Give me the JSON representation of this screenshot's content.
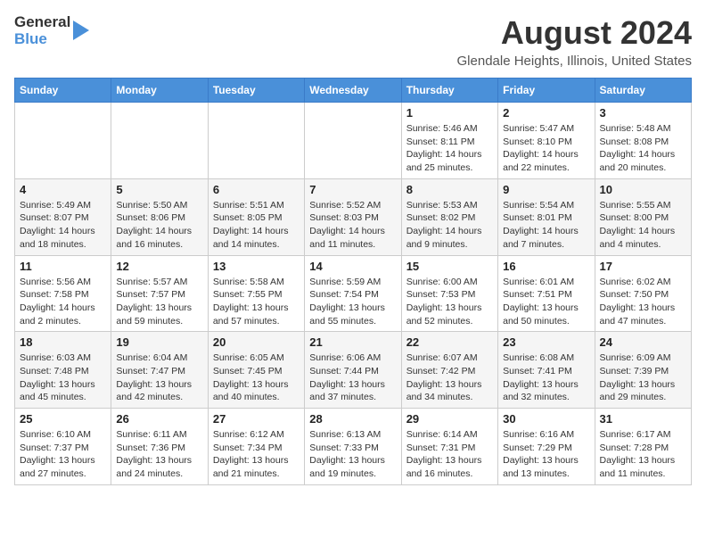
{
  "header": {
    "logo_line1": "General",
    "logo_line2": "Blue",
    "month": "August 2024",
    "location": "Glendale Heights, Illinois, United States"
  },
  "weekdays": [
    "Sunday",
    "Monday",
    "Tuesday",
    "Wednesday",
    "Thursday",
    "Friday",
    "Saturday"
  ],
  "weeks": [
    [
      {
        "day": "",
        "info": ""
      },
      {
        "day": "",
        "info": ""
      },
      {
        "day": "",
        "info": ""
      },
      {
        "day": "",
        "info": ""
      },
      {
        "day": "1",
        "info": "Sunrise: 5:46 AM\nSunset: 8:11 PM\nDaylight: 14 hours\nand 25 minutes."
      },
      {
        "day": "2",
        "info": "Sunrise: 5:47 AM\nSunset: 8:10 PM\nDaylight: 14 hours\nand 22 minutes."
      },
      {
        "day": "3",
        "info": "Sunrise: 5:48 AM\nSunset: 8:08 PM\nDaylight: 14 hours\nand 20 minutes."
      }
    ],
    [
      {
        "day": "4",
        "info": "Sunrise: 5:49 AM\nSunset: 8:07 PM\nDaylight: 14 hours\nand 18 minutes."
      },
      {
        "day": "5",
        "info": "Sunrise: 5:50 AM\nSunset: 8:06 PM\nDaylight: 14 hours\nand 16 minutes."
      },
      {
        "day": "6",
        "info": "Sunrise: 5:51 AM\nSunset: 8:05 PM\nDaylight: 14 hours\nand 14 minutes."
      },
      {
        "day": "7",
        "info": "Sunrise: 5:52 AM\nSunset: 8:03 PM\nDaylight: 14 hours\nand 11 minutes."
      },
      {
        "day": "8",
        "info": "Sunrise: 5:53 AM\nSunset: 8:02 PM\nDaylight: 14 hours\nand 9 minutes."
      },
      {
        "day": "9",
        "info": "Sunrise: 5:54 AM\nSunset: 8:01 PM\nDaylight: 14 hours\nand 7 minutes."
      },
      {
        "day": "10",
        "info": "Sunrise: 5:55 AM\nSunset: 8:00 PM\nDaylight: 14 hours\nand 4 minutes."
      }
    ],
    [
      {
        "day": "11",
        "info": "Sunrise: 5:56 AM\nSunset: 7:58 PM\nDaylight: 14 hours\nand 2 minutes."
      },
      {
        "day": "12",
        "info": "Sunrise: 5:57 AM\nSunset: 7:57 PM\nDaylight: 13 hours\nand 59 minutes."
      },
      {
        "day": "13",
        "info": "Sunrise: 5:58 AM\nSunset: 7:55 PM\nDaylight: 13 hours\nand 57 minutes."
      },
      {
        "day": "14",
        "info": "Sunrise: 5:59 AM\nSunset: 7:54 PM\nDaylight: 13 hours\nand 55 minutes."
      },
      {
        "day": "15",
        "info": "Sunrise: 6:00 AM\nSunset: 7:53 PM\nDaylight: 13 hours\nand 52 minutes."
      },
      {
        "day": "16",
        "info": "Sunrise: 6:01 AM\nSunset: 7:51 PM\nDaylight: 13 hours\nand 50 minutes."
      },
      {
        "day": "17",
        "info": "Sunrise: 6:02 AM\nSunset: 7:50 PM\nDaylight: 13 hours\nand 47 minutes."
      }
    ],
    [
      {
        "day": "18",
        "info": "Sunrise: 6:03 AM\nSunset: 7:48 PM\nDaylight: 13 hours\nand 45 minutes."
      },
      {
        "day": "19",
        "info": "Sunrise: 6:04 AM\nSunset: 7:47 PM\nDaylight: 13 hours\nand 42 minutes."
      },
      {
        "day": "20",
        "info": "Sunrise: 6:05 AM\nSunset: 7:45 PM\nDaylight: 13 hours\nand 40 minutes."
      },
      {
        "day": "21",
        "info": "Sunrise: 6:06 AM\nSunset: 7:44 PM\nDaylight: 13 hours\nand 37 minutes."
      },
      {
        "day": "22",
        "info": "Sunrise: 6:07 AM\nSunset: 7:42 PM\nDaylight: 13 hours\nand 34 minutes."
      },
      {
        "day": "23",
        "info": "Sunrise: 6:08 AM\nSunset: 7:41 PM\nDaylight: 13 hours\nand 32 minutes."
      },
      {
        "day": "24",
        "info": "Sunrise: 6:09 AM\nSunset: 7:39 PM\nDaylight: 13 hours\nand 29 minutes."
      }
    ],
    [
      {
        "day": "25",
        "info": "Sunrise: 6:10 AM\nSunset: 7:37 PM\nDaylight: 13 hours\nand 27 minutes."
      },
      {
        "day": "26",
        "info": "Sunrise: 6:11 AM\nSunset: 7:36 PM\nDaylight: 13 hours\nand 24 minutes."
      },
      {
        "day": "27",
        "info": "Sunrise: 6:12 AM\nSunset: 7:34 PM\nDaylight: 13 hours\nand 21 minutes."
      },
      {
        "day": "28",
        "info": "Sunrise: 6:13 AM\nSunset: 7:33 PM\nDaylight: 13 hours\nand 19 minutes."
      },
      {
        "day": "29",
        "info": "Sunrise: 6:14 AM\nSunset: 7:31 PM\nDaylight: 13 hours\nand 16 minutes."
      },
      {
        "day": "30",
        "info": "Sunrise: 6:16 AM\nSunset: 7:29 PM\nDaylight: 13 hours\nand 13 minutes."
      },
      {
        "day": "31",
        "info": "Sunrise: 6:17 AM\nSunset: 7:28 PM\nDaylight: 13 hours\nand 11 minutes."
      }
    ]
  ]
}
